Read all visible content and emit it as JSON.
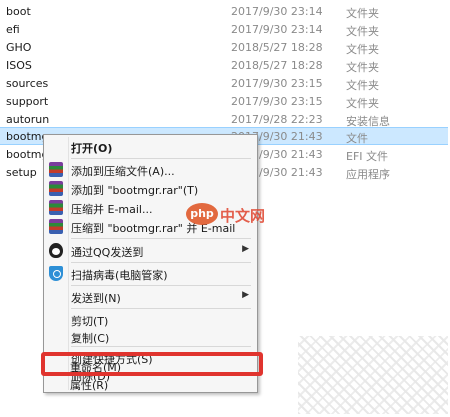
{
  "files": [
    {
      "name": "boot",
      "date": "2017/9/30 23:14",
      "type": "文件夹"
    },
    {
      "name": "efi",
      "date": "2017/9/30 23:14",
      "type": "文件夹"
    },
    {
      "name": "GHO",
      "date": "2018/5/27 18:28",
      "type": "文件夹"
    },
    {
      "name": "ISOS",
      "date": "2018/5/27 18:28",
      "type": "文件夹"
    },
    {
      "name": "sources",
      "date": "2017/9/30 23:15",
      "type": "文件夹"
    },
    {
      "name": "support",
      "date": "2017/9/30 23:15",
      "type": "文件夹"
    },
    {
      "name": "autorun",
      "date": "2017/9/28 22:23",
      "type": "安装信息"
    },
    {
      "name": "bootmgr",
      "date": "2017/9/30 21:43",
      "type": "文件"
    },
    {
      "name": "bootmg",
      "date": "2017/9/30 21:43",
      "type": "EFI 文件"
    },
    {
      "name": "setup",
      "date": "2017/9/30 21:43",
      "type": "应用程序"
    }
  ],
  "menu": {
    "open": "打开(O)",
    "add_to_archive": "添加到压缩文件(A)...",
    "add_to_rar": "添加到 \"bootmgr.rar\"(T)",
    "compress_email": "压缩并 E-mail...",
    "compress_rar_email": "压缩到 \"bootmgr.rar\" 并 E-mail",
    "send_qq": "通过QQ发送到",
    "scan_virus": "扫描病毒(电脑管家)",
    "send_to": "发送到(N)",
    "cut": "剪切(T)",
    "copy": "复制(C)",
    "create_shortcut": "创建快捷方式(S)",
    "delete": "删除(D)",
    "rename": "重命名(M)",
    "properties": "属性(R)",
    "submenu_arrow": "▶"
  },
  "watermark": {
    "badge": "php",
    "text": "中文网"
  },
  "colors": {
    "selection": "#cce8ff",
    "highlight_box": "#e0342e",
    "menu_bg": "#f6f6f6"
  }
}
